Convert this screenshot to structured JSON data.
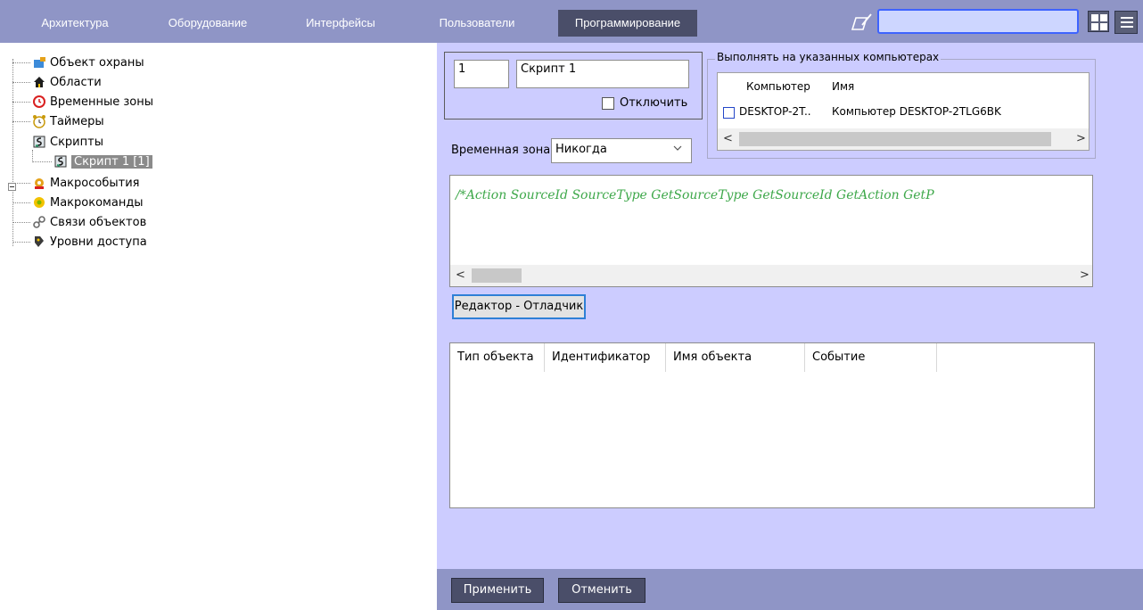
{
  "tabs": [
    {
      "label": "Архитектура"
    },
    {
      "label": "Оборудование"
    },
    {
      "label": "Интерфейсы"
    },
    {
      "label": "Пользователи"
    },
    {
      "label": "Программирование",
      "active": true
    }
  ],
  "toolbar": {
    "search_value": ""
  },
  "tree": {
    "items": [
      {
        "label": "Объект охраны",
        "icon": "shield-object-icon"
      },
      {
        "label": "Области",
        "icon": "house-icon"
      },
      {
        "label": "Временные зоны",
        "icon": "clock-icon"
      },
      {
        "label": "Таймеры",
        "icon": "alarm-clock-icon"
      },
      {
        "label": "Скрипты",
        "icon": "script-icon"
      },
      {
        "label": "Скрипт 1 [1]",
        "icon": "script-icon",
        "selected": true
      },
      {
        "label": "Макрособытия",
        "icon": "macro-event-icon"
      },
      {
        "label": "Макрокоманды",
        "icon": "macro-command-icon"
      },
      {
        "label": "Связи объектов",
        "icon": "link-icon"
      },
      {
        "label": "Уровни доступа",
        "icon": "access-level-icon"
      }
    ]
  },
  "script": {
    "id": "1",
    "name": "Скрипт 1",
    "disable_label": "Отключить",
    "disabled": false
  },
  "computers": {
    "title": "Выполнять на указанных компьютерах",
    "columns": [
      "Компьютер",
      "Имя"
    ],
    "rows": [
      {
        "computer": "DESKTOP-2T..",
        "name": "Компьютер DESKTOP-2TLG6BK",
        "checked": false
      }
    ]
  },
  "timezone": {
    "label": "Временная зона",
    "value": "Никогда"
  },
  "code": {
    "text": "/*Action SourceId SourceType GetSourceType GetSourceId GetAction GetP"
  },
  "debugger_button": "Редактор - Отладчик",
  "events_table": {
    "columns": [
      "Тип объекта",
      "Идентификатор",
      "Имя объекта",
      "Событие"
    ]
  },
  "footer": {
    "apply": "Применить",
    "cancel": "Отменить"
  },
  "colors": {
    "tabbar": "#8f95c6",
    "active_tab": "#4a4e69",
    "panel": "#ccccff",
    "code_text": "#3ea84a",
    "search_border": "#3e63ff"
  }
}
